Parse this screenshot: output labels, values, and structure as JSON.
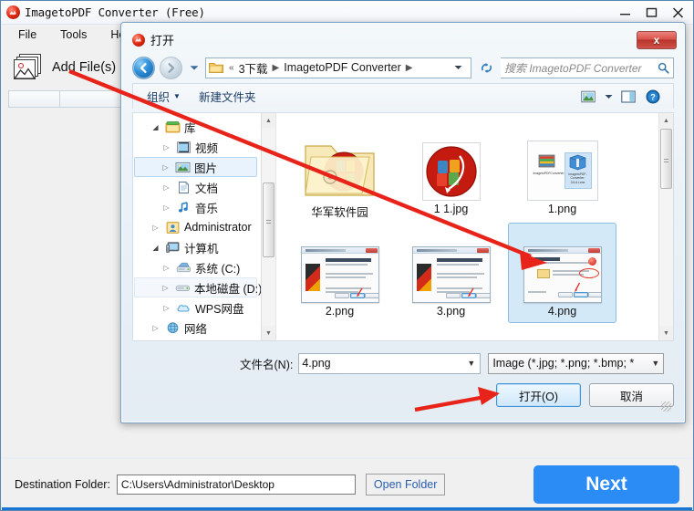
{
  "app": {
    "title": "ImagetoPDF Converter (Free)",
    "title_icon": "app-logo-icon",
    "window_controls": {
      "minimize": "minimize-icon",
      "maximize": "maximize-icon",
      "close": "close-icon"
    },
    "menu": [
      {
        "label": "File"
      },
      {
        "label": "Tools"
      },
      {
        "label": "Help"
      }
    ],
    "toolbar": {
      "add_files_label": "Add File(s)",
      "add_files_icon": "add-image-icon"
    },
    "bottom": {
      "dest_label": "Destination Folder:",
      "dest_value": "C:\\Users\\Administrator\\Desktop",
      "open_folder_label": "Open Folder",
      "next_label": "Next",
      "next_color": "#2b8cf5",
      "status_color": "#1976d2"
    }
  },
  "dialog": {
    "title": "打开",
    "title_icon": "app-logo-icon",
    "close_label": "x",
    "nav": {
      "back_icon": "back-arrow-icon",
      "forward_icon": "forward-arrow-icon",
      "history_icon": "chevron-down-icon",
      "refresh_icon": "refresh-icon",
      "folder_icon": "folder-icon",
      "dropdown_icon": "chevron-down-icon"
    },
    "breadcrumb": {
      "overflow": "«",
      "items": [
        "3下载",
        "ImagetoPDF Converter"
      ],
      "separator": "▶"
    },
    "search": {
      "placeholder": "搜索 ImagetoPDF Converter",
      "icon": "search-icon"
    },
    "commandbar": {
      "organize_label": "组织",
      "organize_caret": "▼",
      "new_folder_label": "新建文件夹",
      "view_icon": "view-mode-icon",
      "view_caret": "▼",
      "preview_pane_icon": "preview-pane-icon",
      "help_icon": "help-icon"
    },
    "tree": [
      {
        "label": "库",
        "icon": "library-icon",
        "expander": "expanded",
        "indent": 1,
        "state": "normal"
      },
      {
        "label": "视频",
        "icon": "video-icon",
        "expander": "collapsed",
        "indent": 2,
        "state": "normal"
      },
      {
        "label": "图片",
        "icon": "pictures-icon",
        "expander": "collapsed",
        "indent": 2,
        "state": "selected"
      },
      {
        "label": "文档",
        "icon": "documents-icon",
        "expander": "collapsed",
        "indent": 2,
        "state": "normal"
      },
      {
        "label": "音乐",
        "icon": "music-icon",
        "expander": "collapsed",
        "indent": 2,
        "state": "normal"
      },
      {
        "label": "Administrator",
        "icon": "user-icon",
        "expander": "collapsed",
        "indent": 1,
        "state": "normal"
      },
      {
        "label": "计算机",
        "icon": "computer-icon",
        "expander": "expanded",
        "indent": 1,
        "state": "normal"
      },
      {
        "label": "系统 (C:)",
        "icon": "drive-system-icon",
        "expander": "collapsed",
        "indent": 2,
        "state": "normal"
      },
      {
        "label": "本地磁盘 (D:)",
        "icon": "drive-icon",
        "expander": "collapsed",
        "indent": 2,
        "state": "hover"
      },
      {
        "label": "WPS网盘",
        "icon": "cloud-icon",
        "expander": "collapsed",
        "indent": 2,
        "state": "normal"
      },
      {
        "label": "网络",
        "icon": "network-icon",
        "expander": "collapsed",
        "indent": 1,
        "state": "normal"
      }
    ],
    "tree_scroll": {
      "up_icon": "scroll-up-icon",
      "down_icon": "scroll-down-icon"
    },
    "files": [
      [
        {
          "label": "华军软件园",
          "kind": "folder",
          "selected": false
        },
        {
          "label": "1 1.jpg",
          "kind": "image-round-logo",
          "selected": false
        },
        {
          "label": "1.png",
          "kind": "screenshot-explorer",
          "selected": false
        }
      ],
      [
        {
          "label": "2.png",
          "kind": "screenshot-setup",
          "selected": false
        },
        {
          "label": "3.png",
          "kind": "screenshot-setup",
          "selected": false
        },
        {
          "label": "4.png",
          "kind": "screenshot-install-dir",
          "selected": true
        }
      ],
      [
        {
          "label": "",
          "kind": "screenshot-ready",
          "selected": false
        },
        {
          "label": "",
          "kind": "screenshot-installing",
          "selected": false
        },
        {
          "label": "",
          "kind": "screenshot-complete",
          "selected": false
        }
      ]
    ],
    "footer": {
      "filename_label": "文件名(N):",
      "filename_value": "4.png",
      "filename_caret": "▼",
      "filter_value": "Image (*.jpg; *.png; *.bmp; *",
      "filter_caret": "▼",
      "open_label": "打开(O)",
      "cancel_label": "取消"
    }
  },
  "annotations": {
    "arrow_color": "#e8241a",
    "arrows": [
      {
        "name": "arrow-add-files-to-4png",
        "from": "Add File(s)",
        "to": "4.png"
      },
      {
        "name": "arrow-to-open-button",
        "from": "file list",
        "to": "打开(O)"
      },
      {
        "name": "arrow-to-installer-thumb",
        "from": "1.png thumbnail",
        "to": "installer icon"
      }
    ]
  }
}
